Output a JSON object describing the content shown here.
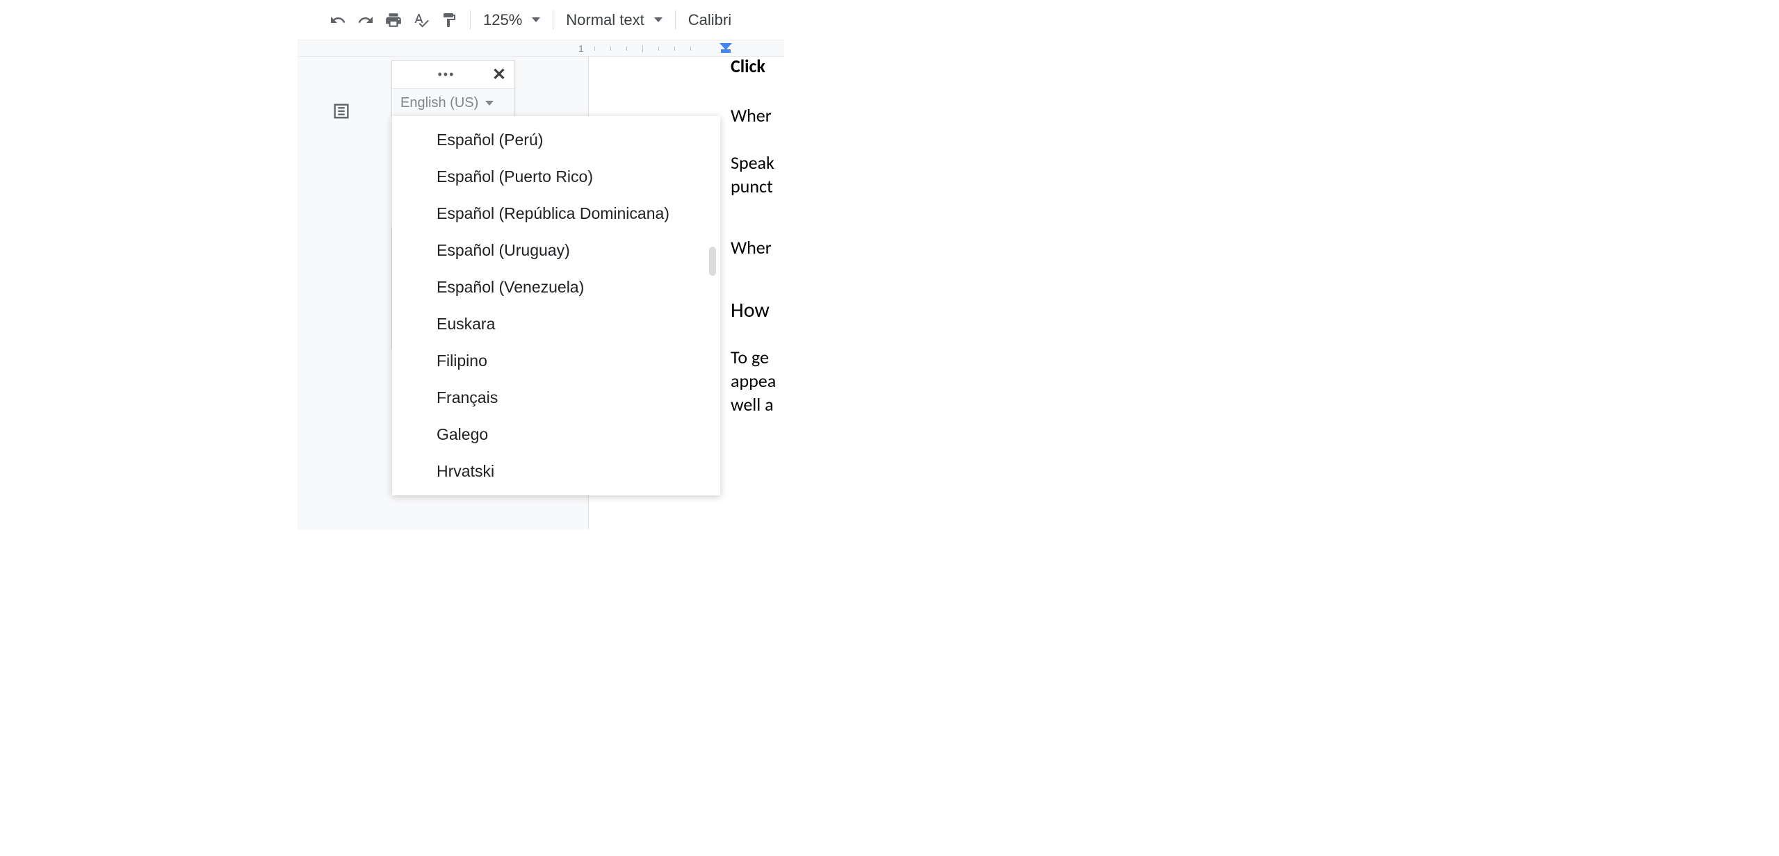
{
  "toolbar": {
    "zoom": "125%",
    "style": "Normal text",
    "font": "Calibri"
  },
  "ruler": {
    "number": "1"
  },
  "voice": {
    "selected_language": "English (US)",
    "languages": [
      "Español (Perú)",
      "Español (Puerto Rico)",
      "Español (República Dominicana)",
      "Español (Uruguay)",
      "Español (Venezuela)",
      "Euskara",
      "Filipino",
      "Français",
      "Galego",
      "Hrvatski"
    ]
  },
  "document": {
    "lines": [
      "Wher",
      "Speak",
      "punct",
      "Wher",
      "How",
      "To ge",
      "appea",
      "well a"
    ]
  }
}
